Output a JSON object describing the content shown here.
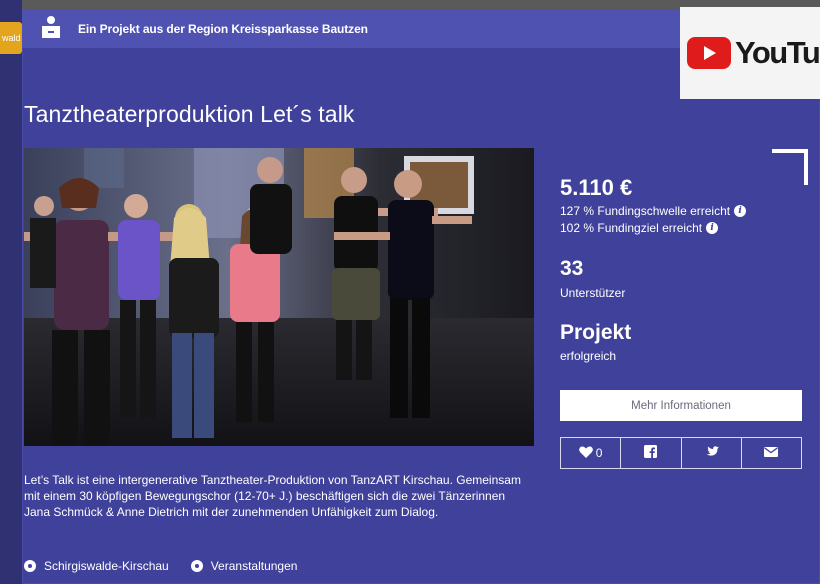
{
  "edge_tab_text": "wald",
  "header": {
    "region_text": "Ein Projekt aus der Region Kreissparkasse Bautzen"
  },
  "youtube": {
    "label": "YouTube"
  },
  "project": {
    "title": "Tanztheaterproduktion Let´s talk",
    "amount": "5.110 €",
    "funding_threshold": "127 % Fundingschwelle erreicht",
    "funding_goal": "102 % Fundingziel erreicht",
    "supporters_count": "33",
    "supporters_label": "Unterstützer",
    "status_title": "Projekt",
    "status_value": "erfolgreich",
    "more_info_label": "Mehr Informationen",
    "likes": "0",
    "description": "Let’s Talk ist eine intergenerative Tanztheater-Produktion von TanzART Kirschau. Gemeinsam mit einem 30 köpfigen Bewegungschor (12-70+ J.) beschäftigen sich die zwei Tänzerinnen Jana Schmück & Anne Dietrich mit der zunehmenden Unfähigkeit zum Dialog.",
    "tags": [
      "Schirgiswalde-Kirschau",
      "Veranstaltungen"
    ]
  },
  "colors": {
    "background": "#3f419a",
    "topbar": "#4f52b0",
    "youtube_red": "#e01b1b"
  }
}
